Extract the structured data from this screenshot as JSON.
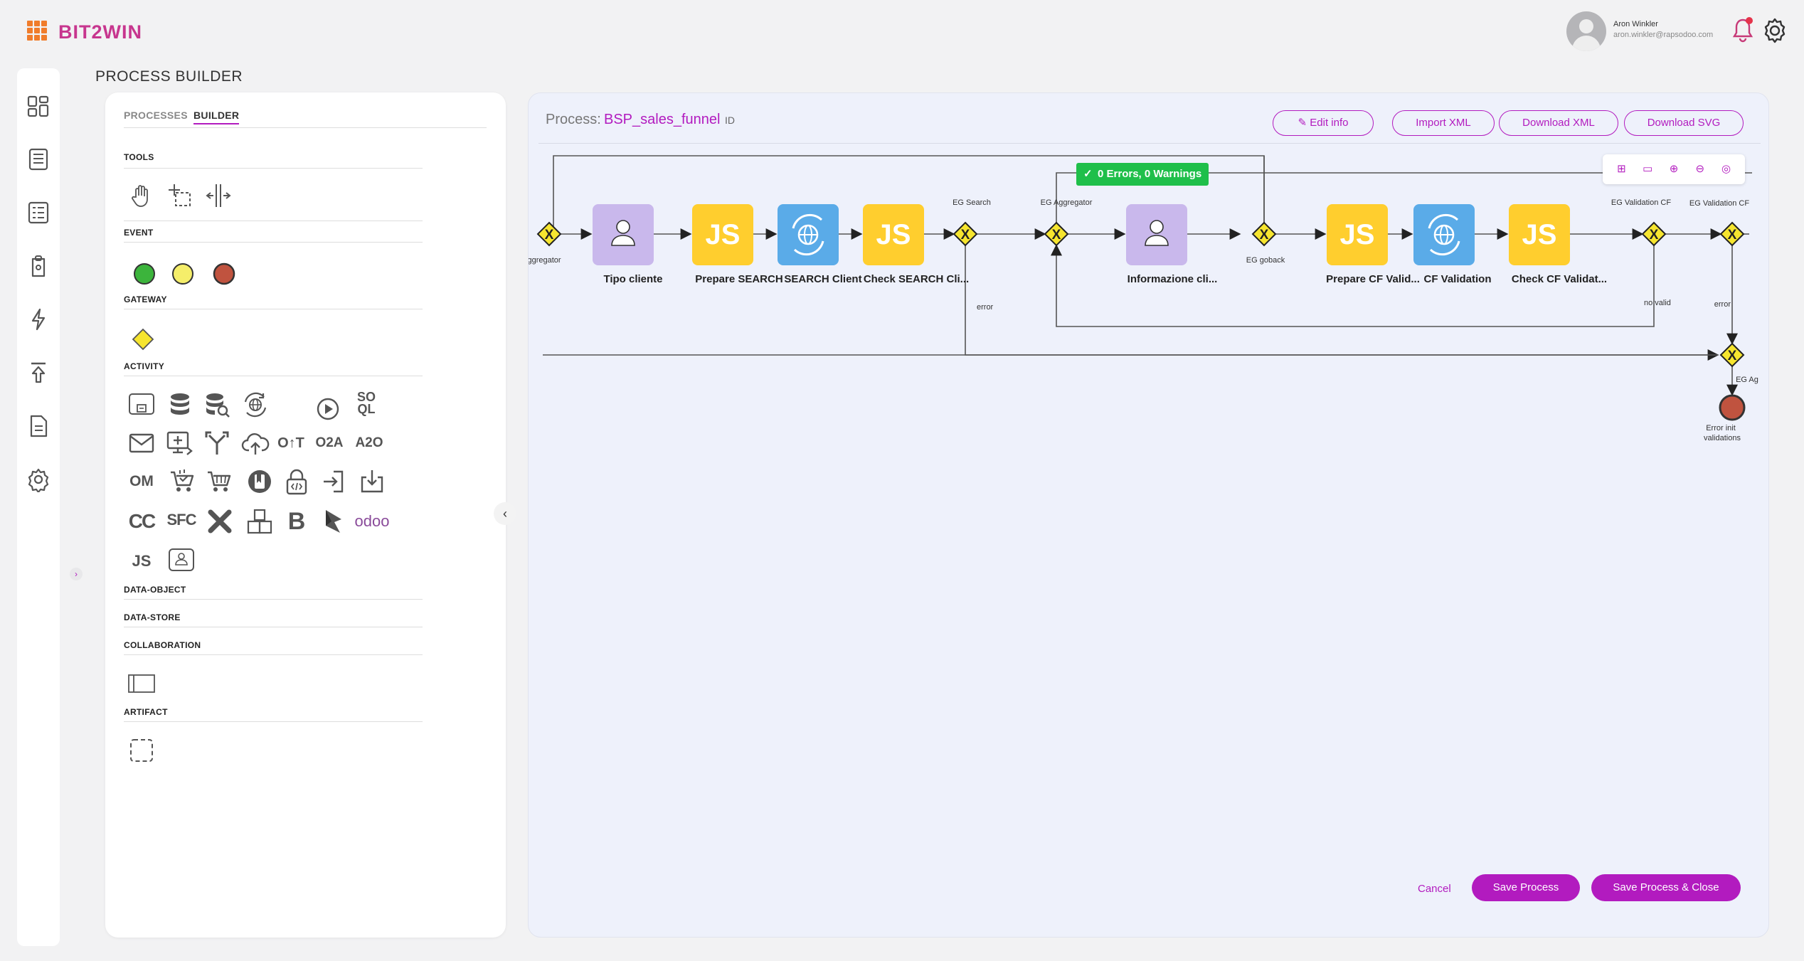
{
  "app": {
    "logo": "BIT2WIN",
    "page_title": "PROCESS BUILDER"
  },
  "user": {
    "name": "Aron Winkler",
    "email": "aron.winkler@rapsodoo.com",
    "icons": [
      "user-avatar",
      "bell-icon",
      "gear-icon"
    ]
  },
  "sidebar": {
    "items": [
      {
        "icon": "dashboard-icon"
      },
      {
        "icon": "catalog-icon"
      },
      {
        "icon": "tasks-icon"
      },
      {
        "icon": "clipboard-icon"
      },
      {
        "icon": "flash-icon"
      },
      {
        "icon": "deploy-icon"
      },
      {
        "icon": "document-icon"
      },
      {
        "icon": "settings-icon"
      }
    ],
    "expand_icon": "›"
  },
  "builder": {
    "tabs": [
      "PROCESSES",
      "BUILDER"
    ],
    "active_tab": "BUILDER",
    "sections": {
      "tools": "TOOLS",
      "event": "EVENT",
      "gateway": "GATEWAY",
      "activity": "ACTIVITY",
      "data_object": "DATA-OBJECT",
      "data_store": "DATA-STORE",
      "collaboration": "COLLABORATION",
      "artifact": "ARTIFACT"
    },
    "activity_text_icons": {
      "soql_top": "SO",
      "soql_bottom": "QL",
      "ot": "O↑T",
      "o2a": "O2A",
      "a2o": "A2O",
      "om": "OM",
      "cc": "CC",
      "sfc": "SFC",
      "b": "B",
      "odoo": "odoo",
      "js": "JS"
    },
    "collapse_icon": "‹"
  },
  "process": {
    "label": "Process:",
    "name": "BSP_sales_funnel",
    "id_icon": "ID",
    "buttons": {
      "edit_info": "✎ Edit info",
      "import_xml": "Import XML",
      "download_xml": "Download XML",
      "download_svg": "Download SVG"
    },
    "validation": "0 Errors, 0 Warnings",
    "zoom_tools": [
      "⊞",
      "▭",
      "⊕",
      "⊖",
      "◎"
    ],
    "nodes": {
      "tipo_cliente": "Tipo cliente",
      "prepare_search": "Prepare SEARCH",
      "search_client": "SEARCH Client",
      "check_search": "Check SEARCH Cli...",
      "informazione": "Informazione cli...",
      "prepare_cf": "Prepare CF Valid...",
      "cf_validation": "CF Validation",
      "check_cf": "Check CF Validat...",
      "error_init_1": "Error init",
      "error_init_2": "validations"
    },
    "gateway_labels": {
      "aggregator_left": "ggregator",
      "eg_search": "EG Search",
      "eg_aggregator": "EG Aggregator",
      "eg_goback": "EG goback",
      "eg_validation_cf_1": "EG Validation CF",
      "eg_validation_cf_2": "EG Validation CF",
      "eg_ag": "EG Ag"
    },
    "flow_labels": {
      "error_1": "error",
      "no_valid": "no valid",
      "error_2": "error"
    },
    "task_glyph": "JS",
    "footer": {
      "cancel": "Cancel",
      "save": "Save Process",
      "save_close": "Save Process & Close"
    }
  },
  "colors": {
    "accent": "#b21bbf",
    "user_task": "#c9b8ec",
    "script_task": "#ffce2e",
    "service_task": "#5aabe8",
    "gateway": "#f6e52f",
    "end_event": "#c0533f",
    "start_event": "#3cb43c",
    "intermediate_event": "#f5ee6a",
    "success_badge": "#1fbf4a"
  }
}
